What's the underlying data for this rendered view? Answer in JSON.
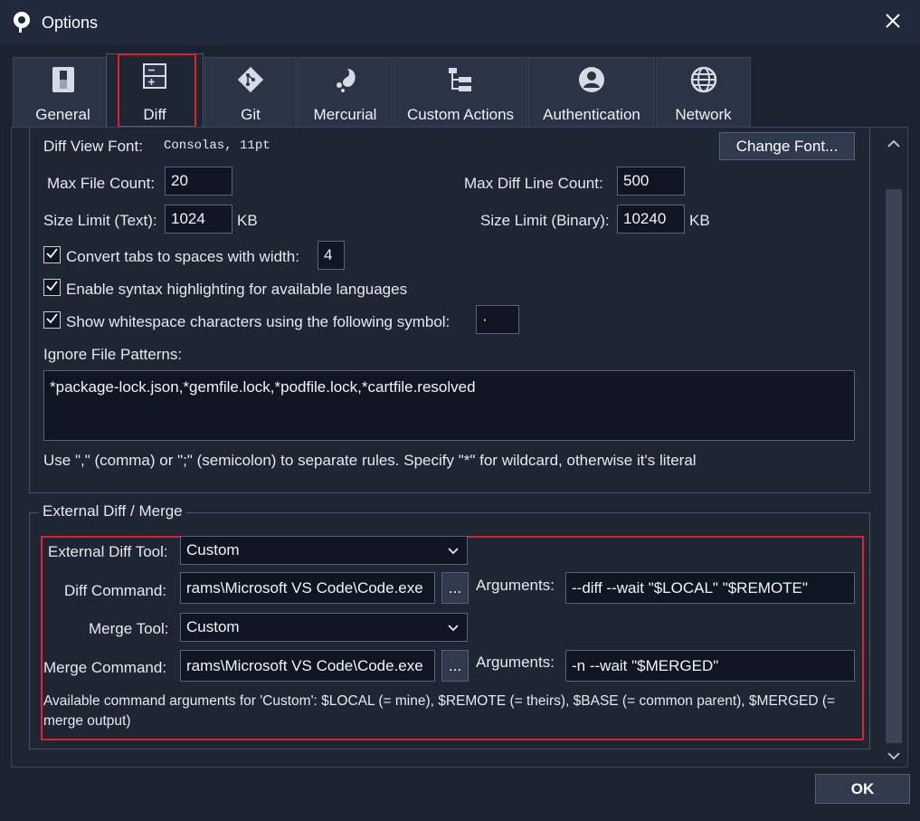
{
  "window": {
    "title": "Options",
    "close_icon": "close-icon"
  },
  "tabs": [
    {
      "label": "General",
      "icon": "toggle-icon"
    },
    {
      "label": "Diff",
      "icon": "diff-icon",
      "active": true
    },
    {
      "label": "Git",
      "icon": "git-icon"
    },
    {
      "label": "Mercurial",
      "icon": "mercurial-icon"
    },
    {
      "label": "Custom Actions",
      "icon": "custom-actions-icon"
    },
    {
      "label": "Authentication",
      "icon": "user-icon"
    },
    {
      "label": "Network",
      "icon": "globe-icon"
    }
  ],
  "diff": {
    "font_label": "Diff View Font:",
    "font_value": "Consolas, 11pt",
    "change_font_button": "Change Font...",
    "max_file_count_label": "Max File Count:",
    "max_file_count": "20",
    "max_diff_line_count_label": "Max Diff Line Count:",
    "max_diff_line_count": "500",
    "size_limit_text_label": "Size Limit (Text):",
    "size_limit_text": "1024",
    "size_limit_binary_label": "Size Limit (Binary):",
    "size_limit_binary": "10240",
    "kb_unit": "KB",
    "convert_tabs_label": "Convert tabs to spaces with width:",
    "convert_tabs_checked": true,
    "tab_width": "4",
    "syntax_highlight_label": "Enable syntax highlighting for available languages",
    "syntax_highlight_checked": true,
    "show_whitespace_label": "Show whitespace characters using the following symbol:",
    "show_whitespace_checked": true,
    "whitespace_symbol": "·",
    "ignore_patterns_label": "Ignore File Patterns:",
    "ignore_patterns_value": "*package-lock.json,*gemfile.lock,*podfile.lock,*cartfile.resolved",
    "ignore_patterns_help": "Use \",\" (comma) or \";\" (semicolon) to separate rules. Specify \"*\" for wildcard, otherwise it's literal"
  },
  "external": {
    "group_title": "External Diff / Merge",
    "diff_tool_label": "External Diff Tool:",
    "diff_tool_value": "Custom",
    "diff_command_label": "Diff Command:",
    "diff_command_value": "rams\\Microsoft VS Code\\Code.exe",
    "browse_label": "...",
    "arguments_label": "Arguments:",
    "diff_arguments_value": "--diff --wait \"$LOCAL\" \"$REMOTE\"",
    "merge_tool_label": "Merge Tool:",
    "merge_tool_value": "Custom",
    "merge_command_label": "Merge Command:",
    "merge_command_value": "rams\\Microsoft VS Code\\Code.exe",
    "merge_arguments_value": "-n --wait \"$MERGED\"",
    "help_text": "Available command arguments for 'Custom': $LOCAL (= mine), $REMOTE (= theirs), $BASE (= common parent), $MERGED (= merge output)"
  },
  "footer": {
    "ok_label": "OK"
  },
  "colors": {
    "accent": "#e02030",
    "background": "#1b2230",
    "panel": "#1e2634",
    "input": "#0f1522"
  }
}
